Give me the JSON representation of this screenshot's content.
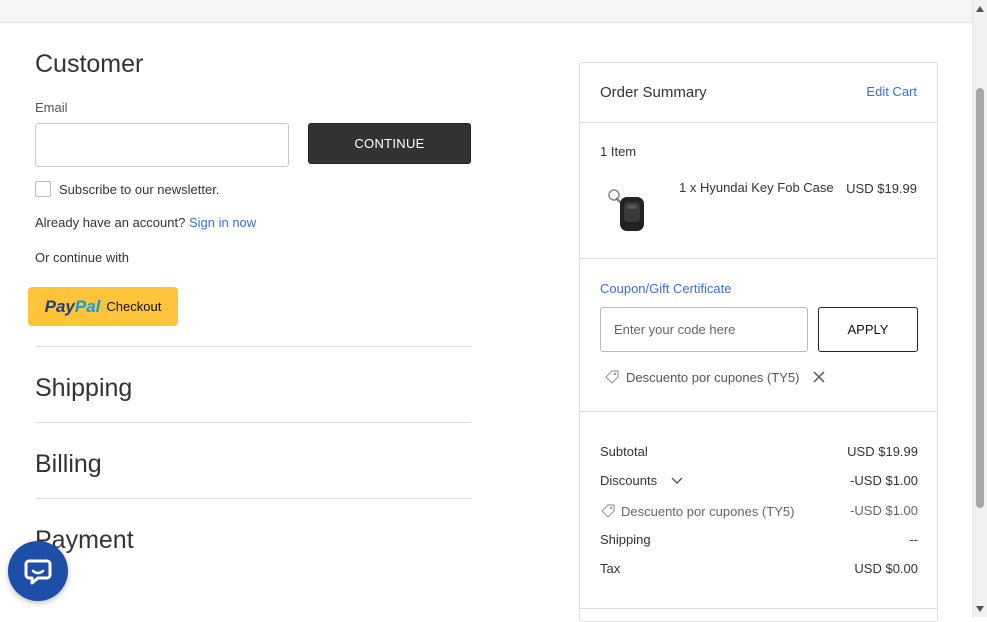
{
  "customer": {
    "title": "Customer",
    "email_label": "Email",
    "email_value": "",
    "continue_label": "CONTINUE",
    "newsletter_label": "Subscribe to our newsletter.",
    "account_prompt": "Already have an account?",
    "sign_in_link": "Sign in now",
    "or_continue": "Or continue with",
    "paypal": {
      "pay": "Pay",
      "pal": "Pal",
      "checkout": "Checkout"
    }
  },
  "sections": {
    "shipping": "Shipping",
    "billing": "Billing",
    "payment": "Payment"
  },
  "summary": {
    "title": "Order Summary",
    "edit_cart": "Edit Cart",
    "item_count": "1 Item",
    "product": {
      "name": "1 x Hyundai Key Fob Case",
      "price": "USD $19.99",
      "image_icon": "key-fob-case-image"
    },
    "coupon": {
      "link": "Coupon/Gift Certificate",
      "placeholder": "Enter your code here",
      "apply_label": "APPLY",
      "applied_code": "Descuento por cupones (TY5)"
    },
    "totals": {
      "subtotal_label": "Subtotal",
      "subtotal_value": "USD $19.99",
      "discounts_label": "Discounts",
      "discounts_value": "-USD $1.00",
      "coupon_line_label": "Descuento por cupones (TY5)",
      "coupon_line_value": "-USD $1.00",
      "shipping_label": "Shipping",
      "shipping_value": "--",
      "tax_label": "Tax",
      "tax_value": "USD $0.00"
    }
  },
  "colors": {
    "link": "#3d6fd1",
    "button_dark": "#333333",
    "paypal_yellow": "#ffc439",
    "chat_blue": "#1d4ea8"
  }
}
